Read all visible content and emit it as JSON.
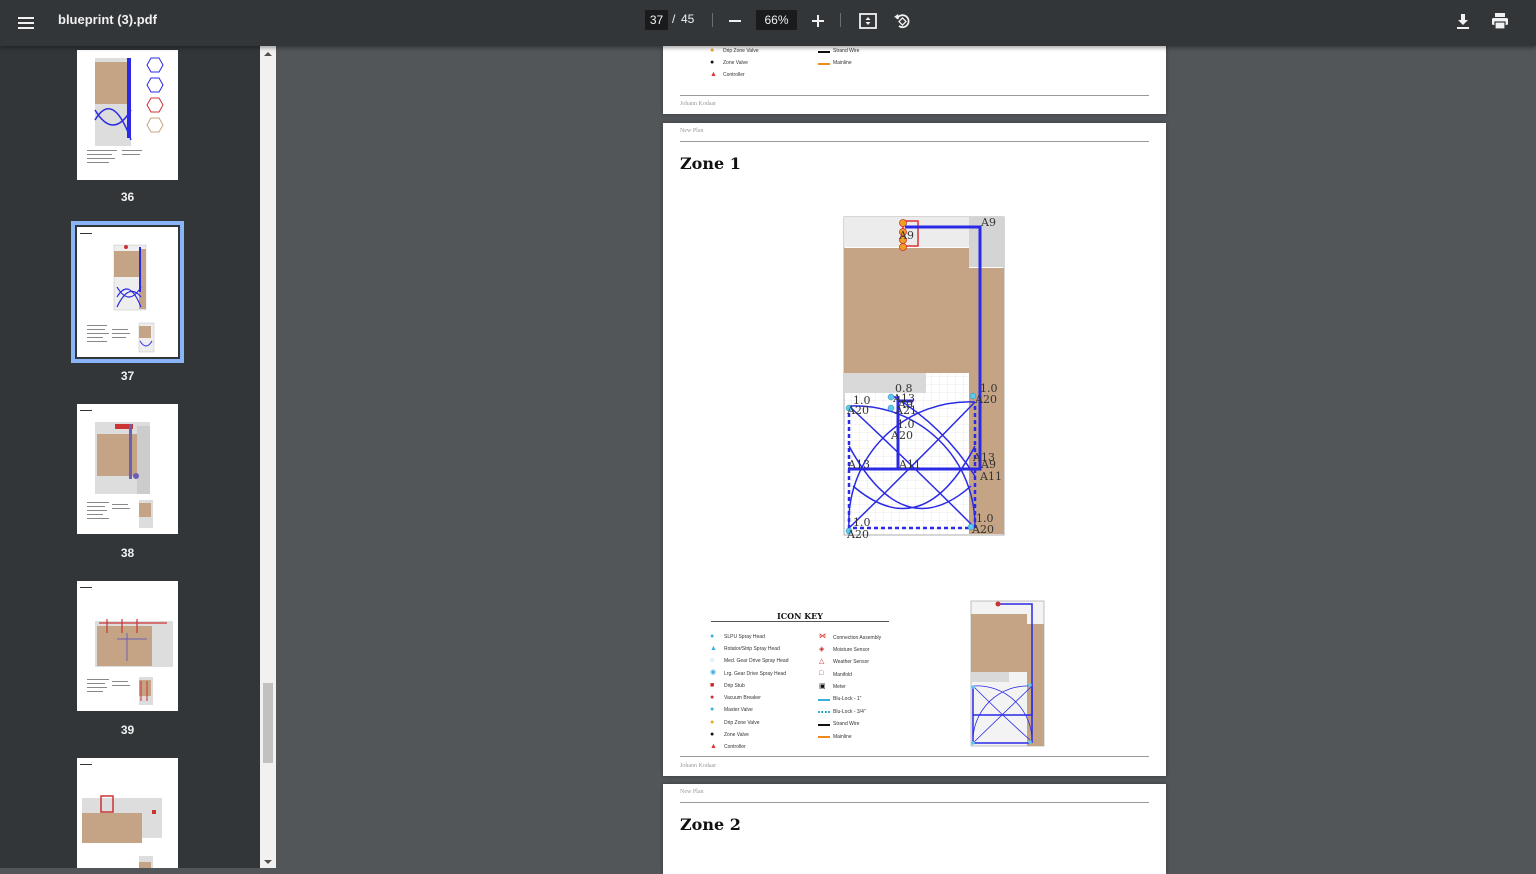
{
  "toolbar": {
    "file_title": "blueprint (3).pdf",
    "current_page": "37",
    "page_separator": "/",
    "total_pages": "45",
    "zoom": "66%"
  },
  "sidebar": {
    "thumbnails": [
      {
        "label": "36"
      },
      {
        "label": "37",
        "selected": true
      },
      {
        "label": "38"
      },
      {
        "label": "39"
      },
      {
        "label": ""
      }
    ]
  },
  "page_prev": {
    "legend_left": [
      "Drip Zone Valve",
      "Zone Valve",
      "Controller"
    ],
    "legend_right": [
      "Strand Wire",
      "Mainline"
    ],
    "footer": "Johann Kodaar"
  },
  "page_current": {
    "header": "New Plan",
    "title": "Zone 1",
    "plan_labels": {
      "a9_top": "A9",
      "a9_valve": "A9",
      "val_08": "0.8",
      "a13_mid": "A13",
      "a9_mid": "A9",
      "a21": "A21",
      "val_10_left": "1.0",
      "a20_left": "A20",
      "val_10_center": "1.0",
      "a20_center": "A20",
      "val_10_right": "1.0",
      "a20_right": "A20",
      "a13_left": "A13",
      "a11_center": "A11",
      "a13_right": "A13",
      "a9_right": "A9",
      "a11_right": "A11",
      "val_10_bl": "1.0",
      "a20_bl": "A20",
      "val_10_br": "1.0",
      "a20_br": "A20"
    },
    "icon_key_title": "ICON KEY",
    "icon_key_left": [
      "SLPU Spray Head",
      "Rotator/Strip Spray Head",
      "Med. Gear Drive Spray Head",
      "Lrg. Gear Drive Spray Head",
      "Drip Stub",
      "Vacuum Breaker",
      "Master Valve",
      "Drip Zone Valve",
      "Zone Valve",
      "Controller"
    ],
    "icon_key_right": [
      "Connection Assembly",
      "Moisture Sensor",
      "Weather Sensor",
      "Manifold",
      "Meter",
      "Blu-Lock - 1\"",
      "Blu-Lock - 3/4\"",
      "Strand Wire",
      "Mainline"
    ],
    "footer": "Johann Kodaar"
  },
  "page_next": {
    "header": "New Plan",
    "title": "Zone 2"
  },
  "colors": {
    "toolbar_bg": "#323639",
    "viewer_bg": "#525659",
    "accent": "#8ab4f8",
    "pipe_blue": "#2a2ae6",
    "house_tan": "#c4a484"
  }
}
